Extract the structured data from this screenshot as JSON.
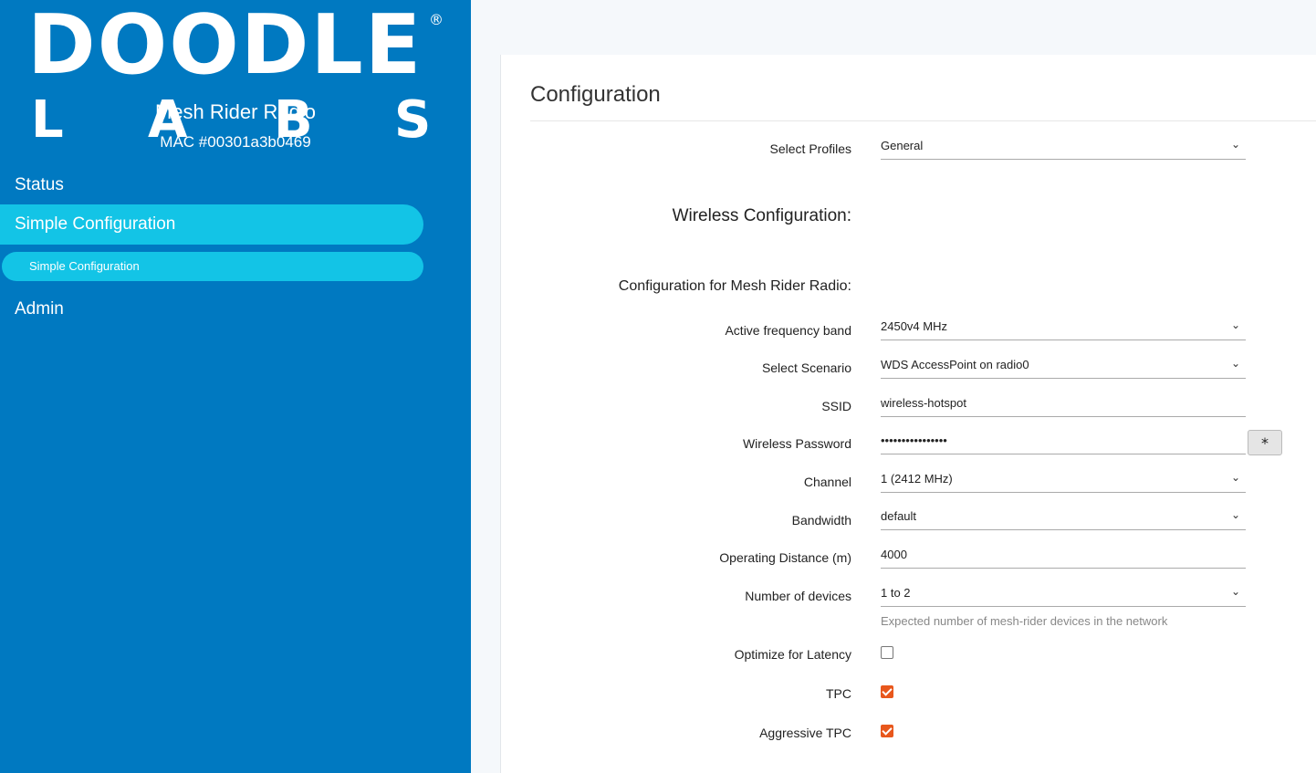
{
  "sidebar": {
    "logo_top": "DOODLE",
    "logo_reg": "®",
    "logo_bottom": [
      "L",
      "A",
      "B",
      "S"
    ],
    "device_name": "Mesh Rider Radio",
    "device_mac": "MAC #00301a3b0469",
    "nav": {
      "status": "Status",
      "simple_config": "Simple Configuration",
      "simple_config_sub": "Simple Configuration",
      "admin": "Admin"
    }
  },
  "main": {
    "title": "Configuration",
    "select_profiles": {
      "label": "Select Profiles",
      "value": "General"
    },
    "wireless_heading": "Wireless Configuration:",
    "radio_heading": "Configuration for Mesh Rider Radio:",
    "fields": {
      "active_band": {
        "label": "Active frequency band",
        "value": "2450v4 MHz"
      },
      "scenario": {
        "label": "Select Scenario",
        "value": "WDS AccessPoint on radio0"
      },
      "ssid": {
        "label": "SSID",
        "value": "wireless-hotspot"
      },
      "password": {
        "label": "Wireless Password",
        "value": "••••••••••••••••",
        "toggle": "*"
      },
      "channel": {
        "label": "Channel",
        "value": "1 (2412 MHz)"
      },
      "bandwidth": {
        "label": "Bandwidth",
        "value": "default"
      },
      "distance": {
        "label": "Operating Distance (m)",
        "value": "4000"
      },
      "num_devices": {
        "label": "Number of devices",
        "value": "1 to 2",
        "hint": "Expected number of mesh-rider devices in the network"
      },
      "optimize_latency": {
        "label": "Optimize for Latency",
        "checked": false
      },
      "tpc": {
        "label": "TPC",
        "checked": true
      },
      "aggressive_tpc": {
        "label": "Aggressive TPC",
        "checked": true
      }
    },
    "chevron": "⌄"
  },
  "colors": {
    "sidebar": "#0079c1",
    "active_pill": "#13c4e6",
    "checkbox": "#e8571c"
  }
}
